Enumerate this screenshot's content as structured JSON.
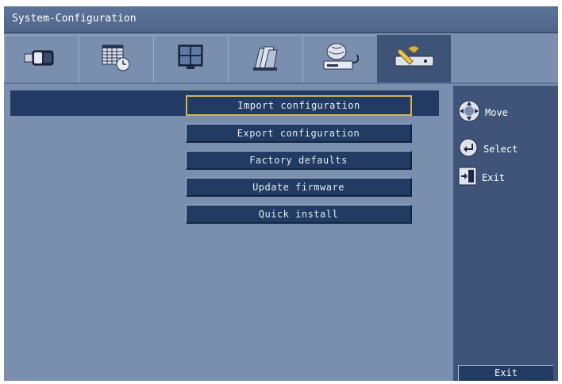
{
  "window": {
    "title": "System-Configuration"
  },
  "tabs": [
    {
      "icon": "camera-icon",
      "active": false
    },
    {
      "icon": "schedule-calendar-icon",
      "active": false
    },
    {
      "icon": "monitor-icon",
      "active": false
    },
    {
      "icon": "archive-icon",
      "active": false
    },
    {
      "icon": "network-icon",
      "active": false
    },
    {
      "icon": "system-tools-icon",
      "active": true
    }
  ],
  "menu": {
    "items": [
      {
        "label": "Import configuration",
        "selected": true
      },
      {
        "label": "Export configuration",
        "selected": false
      },
      {
        "label": "Factory defaults",
        "selected": false
      },
      {
        "label": "Update firmware",
        "selected": false
      },
      {
        "label": "Quick install",
        "selected": false
      }
    ]
  },
  "help": {
    "move": "Move",
    "select": "Select",
    "exit": "Exit"
  },
  "footer": {
    "exit_label": "Exit"
  },
  "colors": {
    "background": "#7a8fae",
    "panel": "#3f5478",
    "button": "#213b63",
    "selection_border": "#d2b25a"
  }
}
